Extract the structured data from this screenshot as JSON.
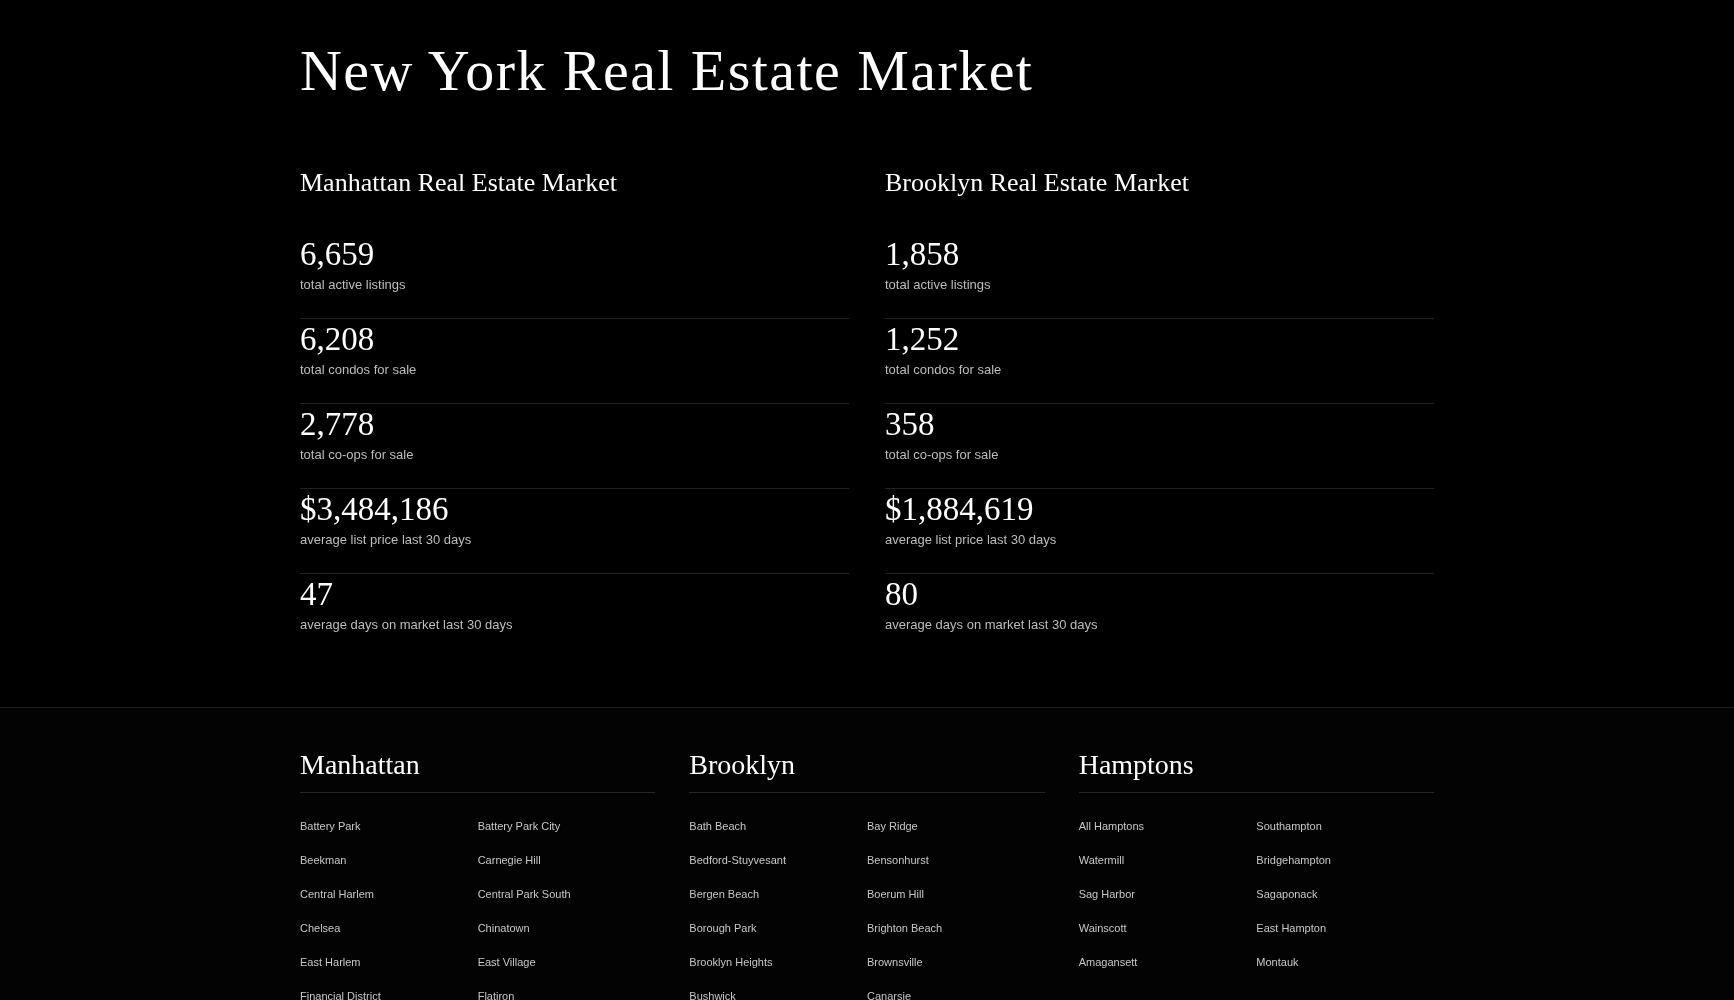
{
  "page_title": "New York Real Estate Market",
  "markets": [
    {
      "title": "Manhattan Real Estate Market",
      "stats": [
        {
          "value": "6,659",
          "label": "total active listings"
        },
        {
          "value": "6,208",
          "label": "total condos for sale"
        },
        {
          "value": "2,778",
          "label": "total co-ops for sale"
        },
        {
          "value": "$3,484,186",
          "label": "average list price last 30 days"
        },
        {
          "value": "47",
          "label": "average days on market last 30 days"
        }
      ]
    },
    {
      "title": "Brooklyn Real Estate Market",
      "stats": [
        {
          "value": "1,858",
          "label": "total active listings"
        },
        {
          "value": "1,252",
          "label": "total condos for sale"
        },
        {
          "value": "358",
          "label": "total co-ops for sale"
        },
        {
          "value": "$1,884,619",
          "label": "average list price last 30 days"
        },
        {
          "value": "80",
          "label": "average days on market last 30 days"
        }
      ]
    }
  ],
  "neighborhoods": [
    {
      "title": "Manhattan",
      "links": [
        "Battery Park",
        "Battery Park City",
        "Beekman",
        "Carnegie Hill",
        "Central Harlem",
        "Central Park South",
        "Chelsea",
        "Chinatown",
        "East Harlem",
        "East Village",
        "Financial District",
        "Flatiron"
      ]
    },
    {
      "title": "Brooklyn",
      "links": [
        "Bath Beach",
        "Bay Ridge",
        "Bedford-Stuyvesant",
        "Bensonhurst",
        "Bergen Beach",
        "Boerum Hill",
        "Borough Park",
        "Brighton Beach",
        "Brooklyn Heights",
        "Brownsville",
        "Bushwick",
        "Canarsie"
      ]
    },
    {
      "title": "Hamptons",
      "links": [
        "All Hamptons",
        "Southampton",
        "Watermill",
        "Bridgehampton",
        "Sag Harbor",
        "Sagaponack",
        "Wainscott",
        "East Hampton",
        "Amagansett",
        "Montauk"
      ]
    }
  ]
}
